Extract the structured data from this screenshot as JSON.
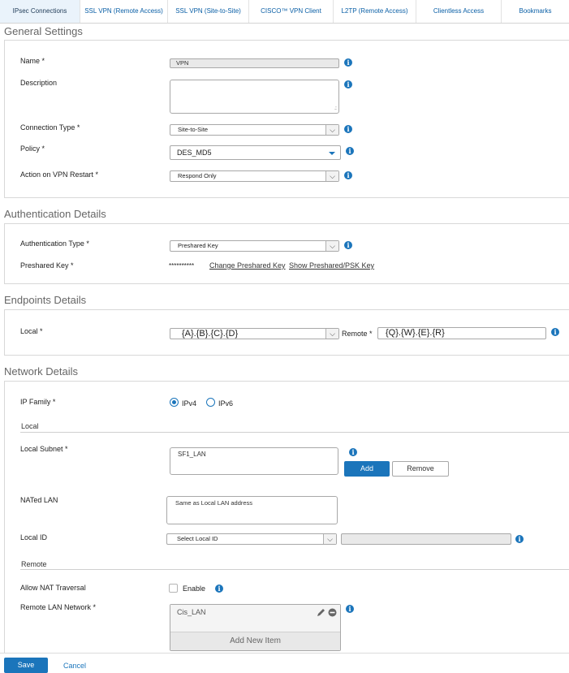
{
  "tabs": [
    {
      "label": "IPsec Connections",
      "active": true
    },
    {
      "label": "SSL VPN (Remote Access)",
      "active": false
    },
    {
      "label": "SSL VPN (Site-to-Site)",
      "active": false
    },
    {
      "label": "CISCO™ VPN Client",
      "active": false
    },
    {
      "label": "L2TP (Remote Access)",
      "active": false
    },
    {
      "label": "Clientless Access",
      "active": false
    },
    {
      "label": "Bookmarks",
      "active": false
    }
  ],
  "general": {
    "title": "General Settings",
    "name_label": "Name *",
    "name_value": "VPN",
    "description_label": "Description",
    "description_value": "",
    "connection_type_label": "Connection Type *",
    "connection_type_value": "Site-to-Site",
    "policy_label": "Policy *",
    "policy_value": "DES_MD5",
    "action_label": "Action on VPN Restart *",
    "action_value": "Respond Only"
  },
  "auth": {
    "title": "Authentication Details",
    "type_label": "Authentication Type *",
    "type_value": "Preshared Key",
    "key_label": "Preshared Key *",
    "key_masked": "**********",
    "change_link": "Change Preshared Key",
    "show_link": "Show Preshared/PSK Key"
  },
  "endpoints": {
    "title": "Endpoints Details",
    "local_label": "Local *",
    "local_value": "{A}.{B}.{C}.{D}",
    "remote_label": "Remote *",
    "remote_value": "{Q}.{W}.{E}.{R}"
  },
  "network": {
    "title": "Network Details",
    "ip_family_label": "IP Family *",
    "ipv4_label": "IPv4",
    "ipv6_label": "IPv6",
    "ip_family_selected": "IPv4",
    "local_heading": "Local",
    "local_subnet_label": "Local Subnet *",
    "local_subnet_value": "SF1_LAN",
    "add_button": "Add",
    "remove_button": "Remove",
    "nated_lan_label": "NATed LAN",
    "nated_lan_value": "Same as Local LAN address",
    "local_id_label": "Local ID",
    "local_id_value": "Select Local ID",
    "local_id_text": "",
    "remote_heading": "Remote",
    "nat_traversal_label": "Allow NAT Traversal",
    "enable_label": "Enable",
    "remote_lan_label": "Remote LAN Network *",
    "remote_lan_item": "Cis_LAN",
    "add_new_item": "Add New Item"
  },
  "footer": {
    "save": "Save",
    "cancel": "Cancel"
  },
  "colors": {
    "accent": "#1b75bb",
    "active_tab_bg": "#eaf3fb"
  },
  "icons": [
    "info-icon",
    "dropdown-arrow-icon",
    "edit-pencil-icon",
    "remove-circle-icon",
    "resize-grip-icon"
  ]
}
